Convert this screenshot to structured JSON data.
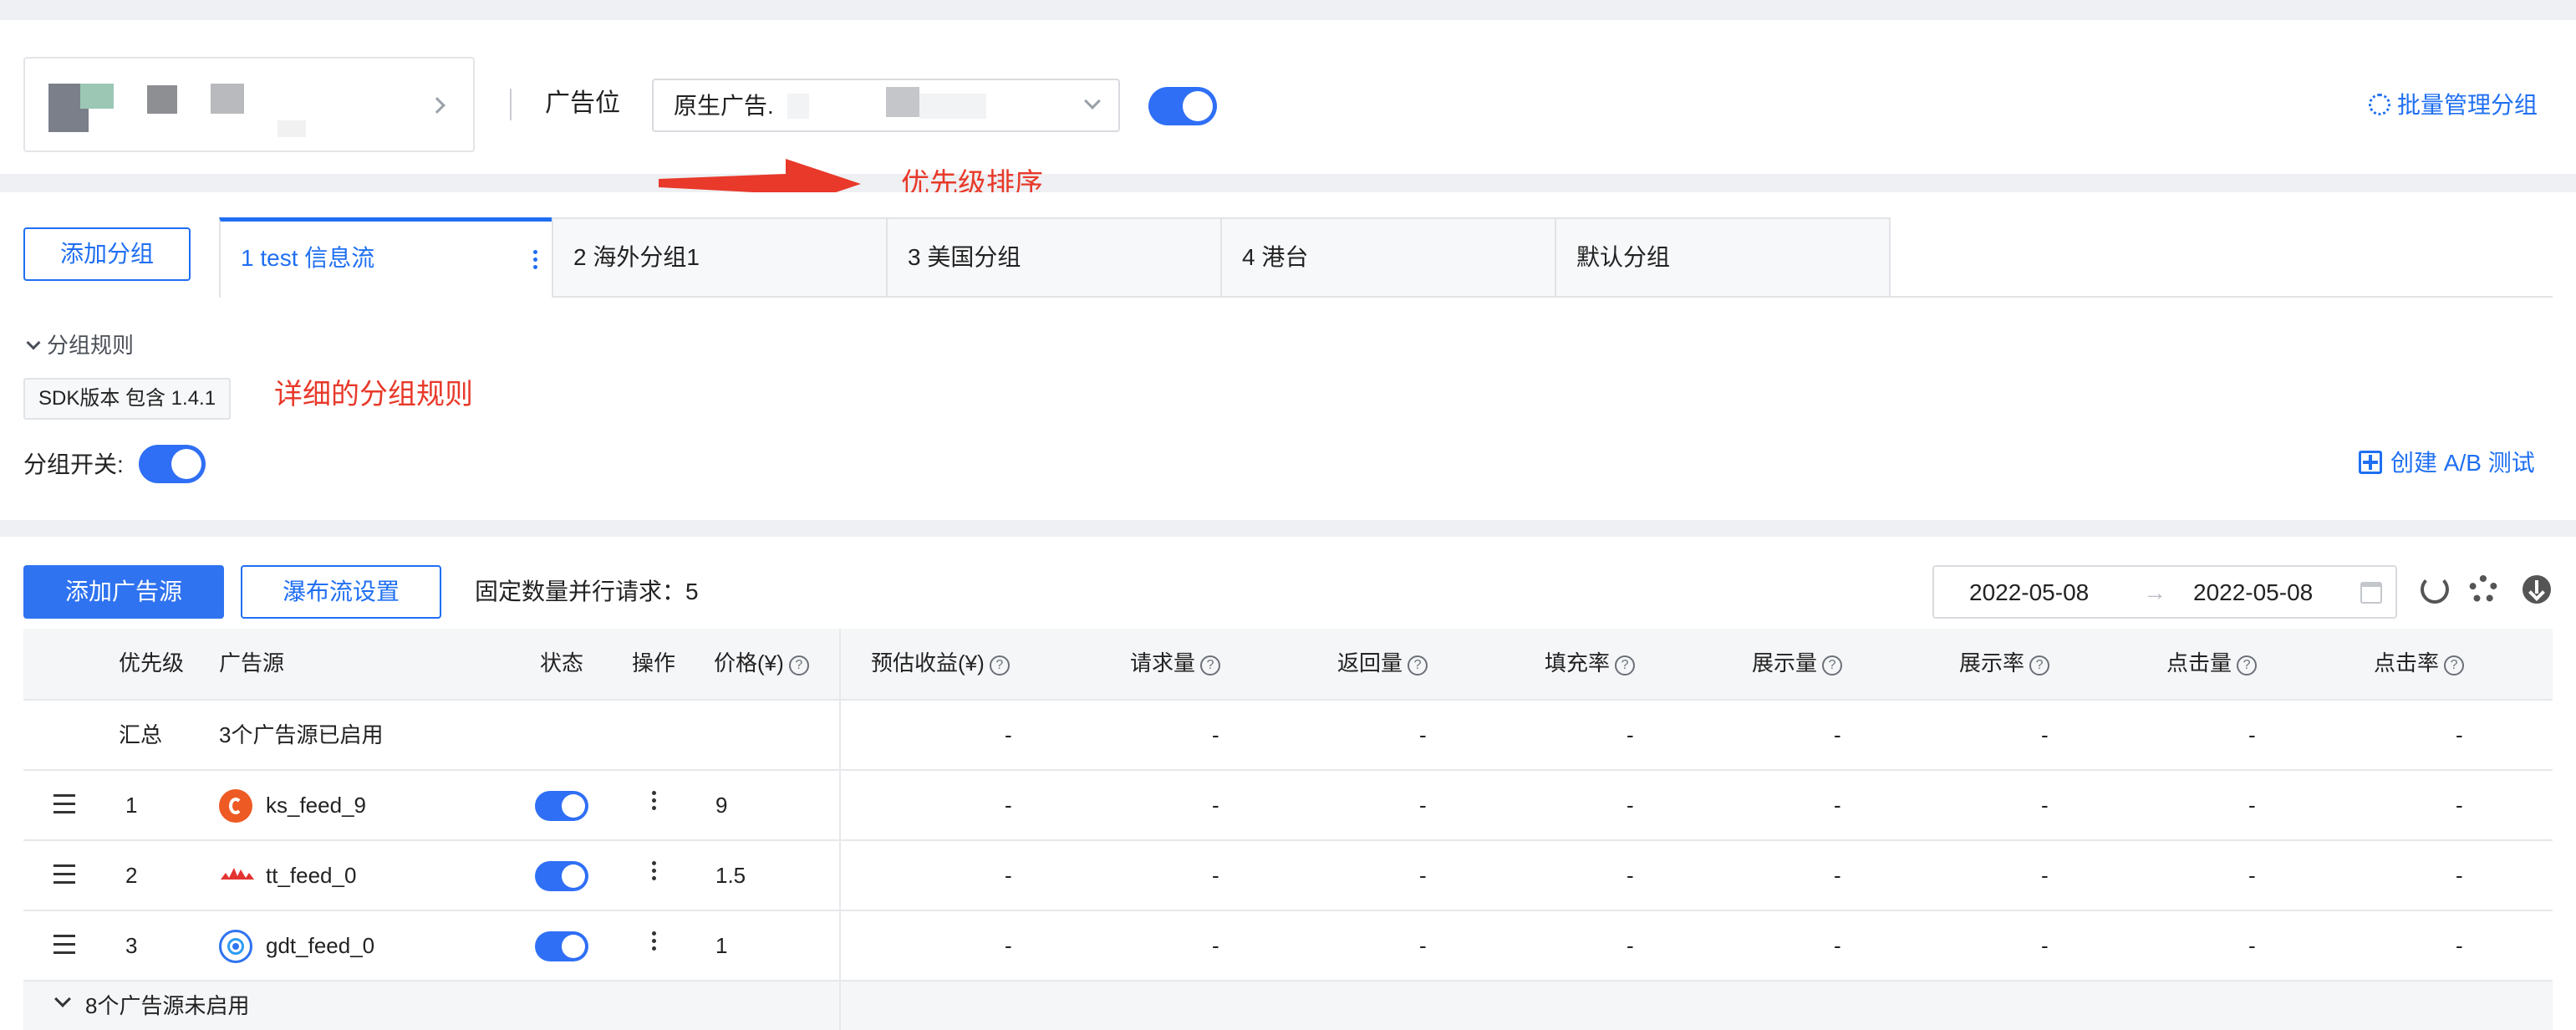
{
  "header": {
    "ad_slot_label": "广告位",
    "ad_slot_value": "原生广告.",
    "batch_manage_label": "批量管理分组"
  },
  "annotations": {
    "priority_sort": "优先级排序",
    "rule_detail": "详细的分组规则"
  },
  "groups": {
    "add_group_label": "添加分组",
    "tabs": [
      {
        "label": "1 test 信息流",
        "active": true
      },
      {
        "label": "2 海外分组1",
        "active": false
      },
      {
        "label": "3 美国分组",
        "active": false
      },
      {
        "label": "4 港台",
        "active": false
      },
      {
        "label": "默认分组",
        "active": false
      }
    ],
    "rules_title": "分组规则",
    "rule_tag": "SDK版本  包含  1.4.1",
    "switch_label": "分组开关:",
    "create_ab_label": "创建 A/B 测试"
  },
  "toolbar": {
    "add_source_label": "添加广告源",
    "waterfall_label": "瀑布流设置",
    "parallel_label": "固定数量并行请求：5",
    "date_start": "2022-05-08",
    "date_end": "2022-05-08"
  },
  "table": {
    "columns": {
      "priority": "优先级",
      "source": "广告源",
      "status": "状态",
      "action": "操作",
      "price": "价格(¥)",
      "est_revenue": "预估收益(¥)",
      "requests": "请求量",
      "returns": "返回量",
      "fill_rate": "填充率",
      "impressions": "展示量",
      "impression_rate": "展示率",
      "clicks": "点击量",
      "ctr": "点击率"
    },
    "summary": {
      "label": "汇总",
      "text": "3个广告源已启用",
      "metrics": [
        "-",
        "-",
        "-",
        "-",
        "-",
        "-",
        "-",
        "-"
      ]
    },
    "rows": [
      {
        "priority": "1",
        "source": "ks_feed_9",
        "icon": "kuaishou-icon",
        "price": "9",
        "metrics": [
          "-",
          "-",
          "-",
          "-",
          "-",
          "-",
          "-",
          "-"
        ]
      },
      {
        "priority": "2",
        "source": "tt_feed_0",
        "icon": "toutiao-icon",
        "price": "1.5",
        "metrics": [
          "-",
          "-",
          "-",
          "-",
          "-",
          "-",
          "-",
          "-"
        ]
      },
      {
        "priority": "3",
        "source": "gdt_feed_0",
        "icon": "gdt-icon",
        "price": "1",
        "metrics": [
          "-",
          "-",
          "-",
          "-",
          "-",
          "-",
          "-",
          "-"
        ]
      }
    ],
    "disabled_label": "8个广告源未启用"
  },
  "colors": {
    "accent": "#1f6ff2",
    "annotation": "#e8392a"
  }
}
